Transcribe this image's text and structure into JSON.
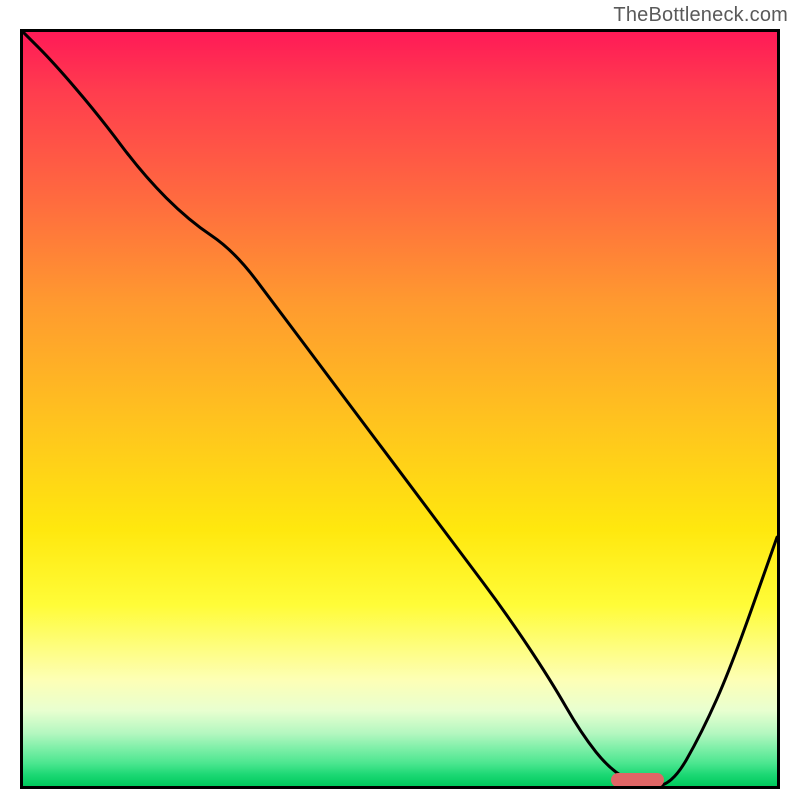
{
  "watermark": {
    "text": "TheBottleneck.com"
  },
  "chart_data": {
    "type": "line",
    "xlim": [
      0,
      100
    ],
    "ylim": [
      0,
      100
    ],
    "grid": false,
    "legend": false,
    "title": "",
    "xlabel": "",
    "ylabel": "",
    "series": [
      {
        "name": "bottleneck-curve",
        "x": [
          0,
          4,
          10,
          16,
          22,
          28,
          34,
          40,
          46,
          52,
          58,
          64,
          70,
          74,
          78,
          82,
          86,
          90,
          94,
          100
        ],
        "values": [
          100,
          96,
          89,
          81,
          75,
          71,
          63,
          55,
          47,
          39,
          31,
          23,
          14,
          7,
          2,
          0,
          0,
          7,
          16,
          33
        ]
      }
    ],
    "marker": {
      "x_start": 78,
      "x_end": 85,
      "y": 0.8,
      "color": "#e06666"
    },
    "gradient_stops": [
      {
        "pos": 0.0,
        "color": "#ff1a57"
      },
      {
        "pos": 0.22,
        "color": "#ff6a3f"
      },
      {
        "pos": 0.52,
        "color": "#ffc41e"
      },
      {
        "pos": 0.76,
        "color": "#fffc38"
      },
      {
        "pos": 0.9,
        "color": "#e8ffd0"
      },
      {
        "pos": 1.0,
        "color": "#00c95c"
      }
    ]
  }
}
